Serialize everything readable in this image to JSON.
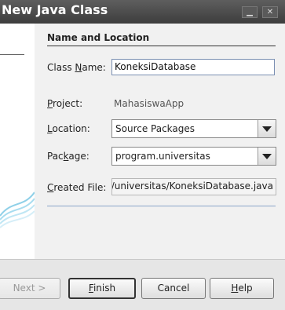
{
  "window": {
    "title": "New Java Class",
    "minimize_glyph": "▁",
    "close_glyph": "✕"
  },
  "form": {
    "section_header": "Name and Location",
    "class_name": {
      "label_pre": "Class ",
      "label_mnemonic": "N",
      "label_post": "ame:",
      "value": "KoneksiDatabase"
    },
    "project": {
      "label_pre": "",
      "label_mnemonic": "P",
      "label_post": "roject:",
      "value": "MahasiswaApp"
    },
    "location": {
      "label_pre": "",
      "label_mnemonic": "L",
      "label_post": "ocation:",
      "value": "Source Packages"
    },
    "package": {
      "label_pre": "Pac",
      "label_mnemonic": "k",
      "label_post": "age:",
      "value": "program.universitas"
    },
    "created_file": {
      "label_pre": "",
      "label_mnemonic": "C",
      "label_post": "reated File:",
      "value": "program/universitas/KoneksiDatabase.java"
    }
  },
  "buttons": {
    "next": "Next >",
    "finish_mnemonic": "F",
    "finish_rest": "inish",
    "cancel": "Cancel",
    "help_mnemonic": "H",
    "help_rest": "elp"
  },
  "colors": {
    "accent_swirl": "#8fd0e8",
    "title_bar": "#4a4a4a"
  }
}
